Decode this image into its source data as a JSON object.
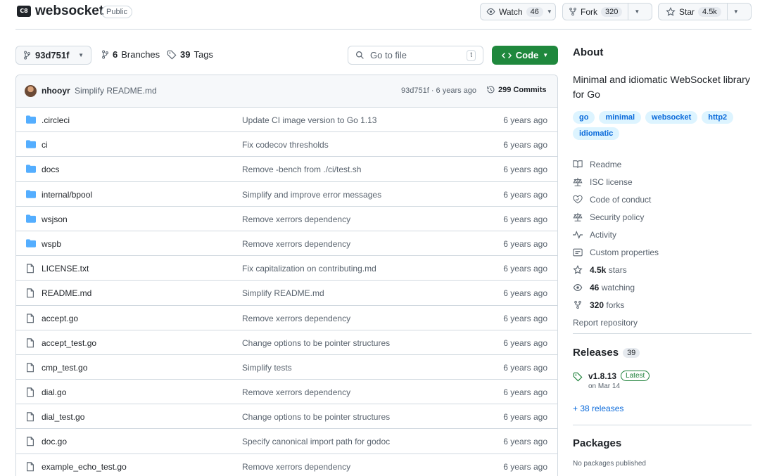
{
  "repo": {
    "logo_text": "C8",
    "name": "websocket",
    "visibility": "Public"
  },
  "header_buttons": {
    "watch_label": "Watch",
    "watch_count": "46",
    "fork_label": "Fork",
    "fork_count": "320",
    "star_label": "Star",
    "star_count": "4.5k"
  },
  "toolbar": {
    "branch": "93d751f",
    "branches_count": "6",
    "branches_label": "Branches",
    "tags_count": "39",
    "tags_label": "Tags",
    "goto_placeholder": "Go to file",
    "goto_kbd": "t",
    "code_label": "Code"
  },
  "latest_commit": {
    "author": "nhooyr",
    "message": "Simplify README.md",
    "meta": "93d751f · 6 years ago",
    "commits": "299 Commits"
  },
  "files": [
    {
      "name": ".circleci",
      "type": "folder",
      "message": "Update CI image version to Go 1.13",
      "time": "6 years ago"
    },
    {
      "name": "ci",
      "type": "folder",
      "message": "Fix codecov thresholds",
      "time": "6 years ago"
    },
    {
      "name": "docs",
      "type": "folder",
      "message": "Remove -bench from ./ci/test.sh",
      "time": "6 years ago"
    },
    {
      "name": "internal/bpool",
      "type": "folder",
      "message": "Simplify and improve error messages",
      "time": "6 years ago"
    },
    {
      "name": "wsjson",
      "type": "folder",
      "message": "Remove xerrors dependency",
      "time": "6 years ago"
    },
    {
      "name": "wspb",
      "type": "folder",
      "message": "Remove xerrors dependency",
      "time": "6 years ago"
    },
    {
      "name": "LICENSE.txt",
      "type": "file",
      "message": "Fix capitalization on contributing.md",
      "time": "6 years ago"
    },
    {
      "name": "README.md",
      "type": "file",
      "message": "Simplify README.md",
      "time": "6 years ago"
    },
    {
      "name": "accept.go",
      "type": "file",
      "message": "Remove xerrors dependency",
      "time": "6 years ago"
    },
    {
      "name": "accept_test.go",
      "type": "file",
      "message": "Change options to be pointer structures",
      "time": "6 years ago"
    },
    {
      "name": "cmp_test.go",
      "type": "file",
      "message": "Simplify tests",
      "time": "6 years ago"
    },
    {
      "name": "dial.go",
      "type": "file",
      "message": "Remove xerrors dependency",
      "time": "6 years ago"
    },
    {
      "name": "dial_test.go",
      "type": "file",
      "message": "Change options to be pointer structures",
      "time": "6 years ago"
    },
    {
      "name": "doc.go",
      "type": "file",
      "message": "Specify canonical import path for godoc",
      "time": "6 years ago"
    },
    {
      "name": "example_echo_test.go",
      "type": "file",
      "message": "Remove xerrors dependency",
      "time": "6 years ago"
    }
  ],
  "about": {
    "title": "About",
    "description": "Minimal and idiomatic WebSocket library for Go",
    "topics": [
      "go",
      "minimal",
      "websocket",
      "http2",
      "idiomatic"
    ],
    "links": [
      {
        "icon": "book-icon",
        "label": "Readme"
      },
      {
        "icon": "law-icon",
        "label": "ISC license"
      },
      {
        "icon": "heart-icon",
        "label": "Code of conduct"
      },
      {
        "icon": "law-icon",
        "label": "Security policy"
      },
      {
        "icon": "pulse-icon",
        "label": "Activity"
      },
      {
        "icon": "note-icon",
        "label": "Custom properties"
      }
    ],
    "stars_count": "4.5k",
    "stars_label": "stars",
    "watching_count": "46",
    "watching_label": "watching",
    "forks_count": "320",
    "forks_label": "forks",
    "report": "Report repository"
  },
  "releases": {
    "title": "Releases",
    "count": "39",
    "latest_name": "v1.8.13",
    "latest_badge": "Latest",
    "latest_date": "on Mar 14",
    "more": "+ 38 releases"
  },
  "packages": {
    "title": "Packages",
    "none": "No packages published"
  },
  "colors": {
    "accent": "#0969da",
    "code_button": "#1f883d",
    "folder": "#54aeff",
    "border": "#d1d9e0"
  }
}
